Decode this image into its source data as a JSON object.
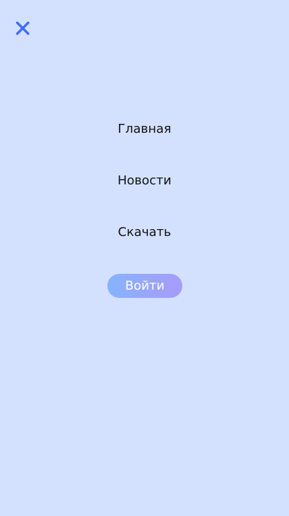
{
  "colors": {
    "background": "#d3e1ff",
    "close_icon": "#3d6bff",
    "nav_text": "#111111",
    "login_gradient_start": "#86b3fd",
    "login_gradient_end": "#a89bfa",
    "login_text": "#ffffff"
  },
  "header": {
    "close_icon": "close-icon"
  },
  "menu": {
    "items": [
      {
        "label": "Главная"
      },
      {
        "label": "Новости"
      },
      {
        "label": "Скачать"
      }
    ]
  },
  "login": {
    "label": "Войти"
  }
}
